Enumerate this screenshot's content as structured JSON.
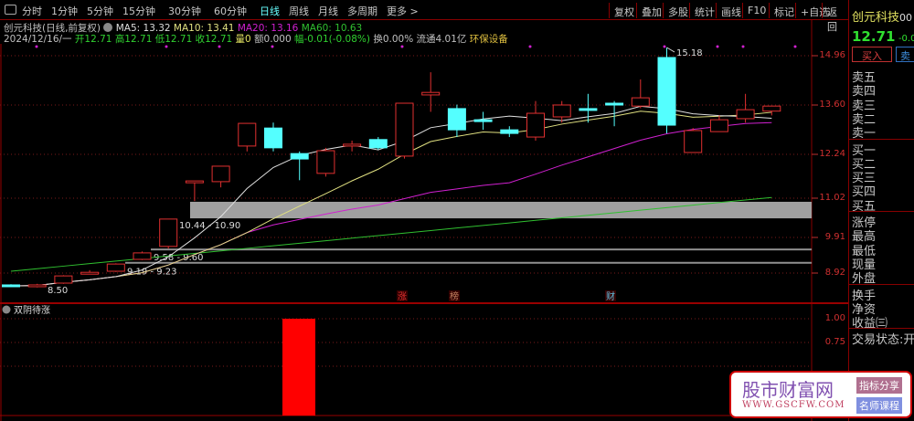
{
  "toolbar": {
    "periods": [
      "分时",
      "1分钟",
      "5分钟",
      "15分钟",
      "30分钟",
      "60分钟",
      "日线",
      "周线",
      "月线",
      "多周期",
      "更多 >"
    ],
    "active": "日线",
    "right_buttons": [
      "复权",
      "叠加",
      "多股",
      "统计",
      "画线",
      "F10",
      "标记",
      "+自选",
      "返回"
    ]
  },
  "header": {
    "title": "创元科技(日线,前复权)",
    "ma5": "MA5: 13.32",
    "ma10": "MA10: 13.41",
    "ma20": "MA20: 13.16",
    "ma60": "MA60: 10.63",
    "date": "2024/12/16/一",
    "open": "开12.71",
    "high": "高12.71",
    "low": "低12.71",
    "close": "收12.71",
    "vol": "量0",
    "amount": "额0.000",
    "change": "幅-0.01(-0.08%)",
    "turnover": "换0.00%",
    "float": "流通4.01亿",
    "sector": "环保设备"
  },
  "axis": {
    "price_ticks": [
      "14.96",
      "13.60",
      "12.24",
      "11.02",
      "9.91",
      "8.92"
    ],
    "ind_ticks": [
      "1.00",
      "0.75"
    ]
  },
  "annotations": {
    "high": "15.18",
    "low": "8.50",
    "zone1": "10.44 - 10.90",
    "zone2": "9.58 - 9.60",
    "zone3": "9.19 - 9.23",
    "markers": [
      "涨",
      "榜",
      "财"
    ]
  },
  "indicator": {
    "name": "双阴待涨",
    "value": 1.0
  },
  "candles": [
    [
      8.59,
      8.56,
      8.61,
      8.54
    ],
    [
      8.56,
      8.59,
      8.62,
      8.52
    ],
    [
      8.64,
      8.84,
      8.86,
      8.62
    ],
    [
      8.9,
      8.94,
      9.0,
      8.9
    ],
    [
      8.97,
      9.17,
      9.19,
      8.95
    ],
    [
      9.3,
      9.48,
      9.52,
      9.28
    ],
    [
      9.66,
      10.42,
      10.42,
      9.6
    ],
    [
      11.48,
      11.48,
      11.48,
      10.92
    ],
    [
      11.46,
      11.89,
      11.89,
      11.3
    ],
    [
      12.45,
      13.08,
      13.08,
      12.3
    ],
    [
      12.95,
      12.4,
      13.1,
      12.3
    ],
    [
      12.24,
      12.09,
      12.3,
      11.5
    ],
    [
      11.69,
      12.32,
      12.4,
      11.6
    ],
    [
      12.46,
      12.5,
      12.6,
      12.3
    ],
    [
      12.63,
      12.4,
      12.7,
      12.35
    ],
    [
      12.17,
      13.64,
      13.64,
      12.1
    ],
    [
      13.87,
      13.94,
      14.5,
      13.4
    ],
    [
      13.49,
      12.9,
      13.6,
      12.7
    ],
    [
      13.18,
      13.13,
      13.4,
      12.9
    ],
    [
      12.9,
      12.8,
      13.0,
      12.7
    ],
    [
      12.7,
      13.36,
      13.7,
      12.6
    ],
    [
      13.26,
      13.59,
      13.7,
      13.1
    ],
    [
      13.49,
      13.44,
      13.9,
      13.1
    ],
    [
      13.64,
      13.59,
      13.7,
      13.0
    ],
    [
      13.56,
      13.79,
      14.3,
      13.5
    ],
    [
      14.91,
      13.03,
      15.18,
      12.8
    ],
    [
      12.27,
      12.88,
      12.95,
      12.27
    ],
    [
      12.85,
      13.18,
      13.3,
      12.85
    ],
    [
      13.21,
      13.46,
      13.9,
      13.1
    ],
    [
      13.42,
      13.56,
      13.56,
      13.3
    ]
  ],
  "ma60_range": [
    8.97,
    11.02
  ],
  "colors": {
    "up": "#e03030",
    "down": "#54ffff",
    "ma5": "#e0e0e0",
    "ma10": "#e0e080",
    "ma20": "#d020d0",
    "ma60": "#30c030"
  },
  "right_panel": {
    "name": "创元科技",
    "code": "00",
    "price": "12.71",
    "change": "-0.0",
    "buy": "买入",
    "sell": "卖",
    "asks": [
      "卖五",
      "卖四",
      "卖三",
      "卖二",
      "卖一"
    ],
    "bids": [
      "买一",
      "买二",
      "买三",
      "买四",
      "买五"
    ],
    "stats": [
      "涨停",
      "最高",
      "最低",
      "现量",
      "外盘"
    ],
    "fin": [
      "换手",
      "净资",
      "收益㈢"
    ],
    "status": "交易状态:开"
  },
  "watermark": {
    "site": "股市财富网",
    "url": "WWW.GSCFW.COM",
    "tag1": "指标分享",
    "tag2": "名师课程"
  }
}
